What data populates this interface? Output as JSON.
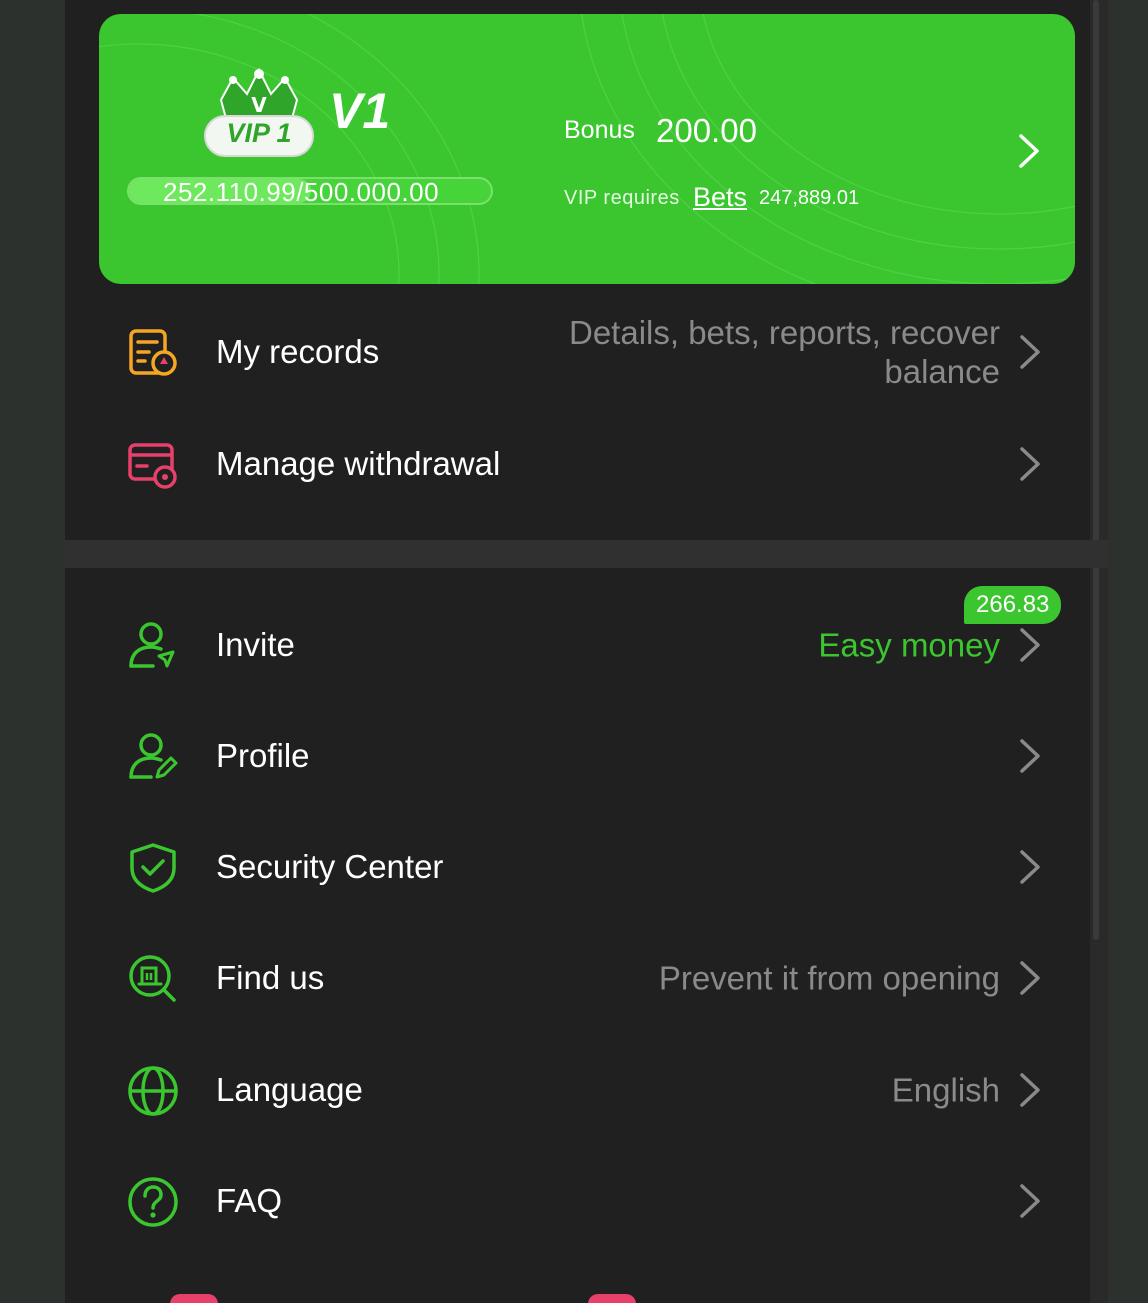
{
  "vip": {
    "badge_text": "VIP 1",
    "level": "V1",
    "progress_text": "252.110.99/500.000.00",
    "progress_fraction": 0.504,
    "bonus_label": "Bonus",
    "bonus_value": "200.00",
    "requires_label": "VIP requires",
    "requires_link": "Bets",
    "requires_value": "247,889.01"
  },
  "records": {
    "label": "My records",
    "hint_line1": "Details, bets, reports, recover",
    "hint_line2": "balance"
  },
  "withdrawal": {
    "label": "Manage withdrawal"
  },
  "invite": {
    "label": "Invite",
    "hint": "Easy money",
    "badge": "266.83"
  },
  "profile": {
    "label": "Profile"
  },
  "security": {
    "label": "Security Center"
  },
  "findus": {
    "label": "Find us",
    "hint": "Prevent it from opening"
  },
  "language": {
    "label": "Language",
    "hint": "English"
  },
  "faq": {
    "label": "FAQ"
  },
  "colors": {
    "accent": "#3bc630",
    "panel": "#202020",
    "pink": "#e7416b",
    "orange": "#f5a623"
  }
}
